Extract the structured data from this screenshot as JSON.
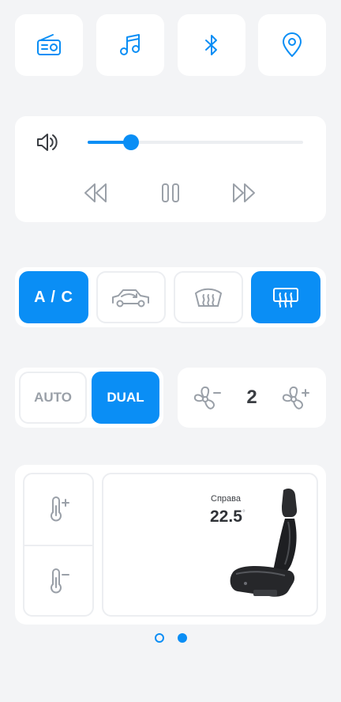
{
  "quick_buttons": [
    {
      "icon": "radio-icon"
    },
    {
      "icon": "music-note-icon"
    },
    {
      "icon": "bluetooth-icon"
    },
    {
      "icon": "location-pin-icon"
    }
  ],
  "media": {
    "volume_level": 0.2,
    "controls": [
      "rewind-icon",
      "pause-icon",
      "fast-forward-icon"
    ]
  },
  "climate_buttons": [
    {
      "label": "A / C",
      "active": true
    },
    {
      "icon": "recirculation-car-icon",
      "active": false
    },
    {
      "icon": "front-defrost-icon",
      "active": false
    },
    {
      "icon": "rear-defrost-icon",
      "active": true
    }
  ],
  "mode": {
    "auto_label": "AUTO",
    "dual_label": "DUAL",
    "selected": "DUAL"
  },
  "fan": {
    "speed": "2"
  },
  "seat": {
    "side_label": "Справа",
    "temperature": "22.5",
    "degree_symbol": "°"
  },
  "pager": {
    "pages": 2,
    "current": 2
  },
  "colors": {
    "accent": "#0a8ef5",
    "background": "#f3f4f6",
    "icon_gray": "#9aa0a8"
  }
}
